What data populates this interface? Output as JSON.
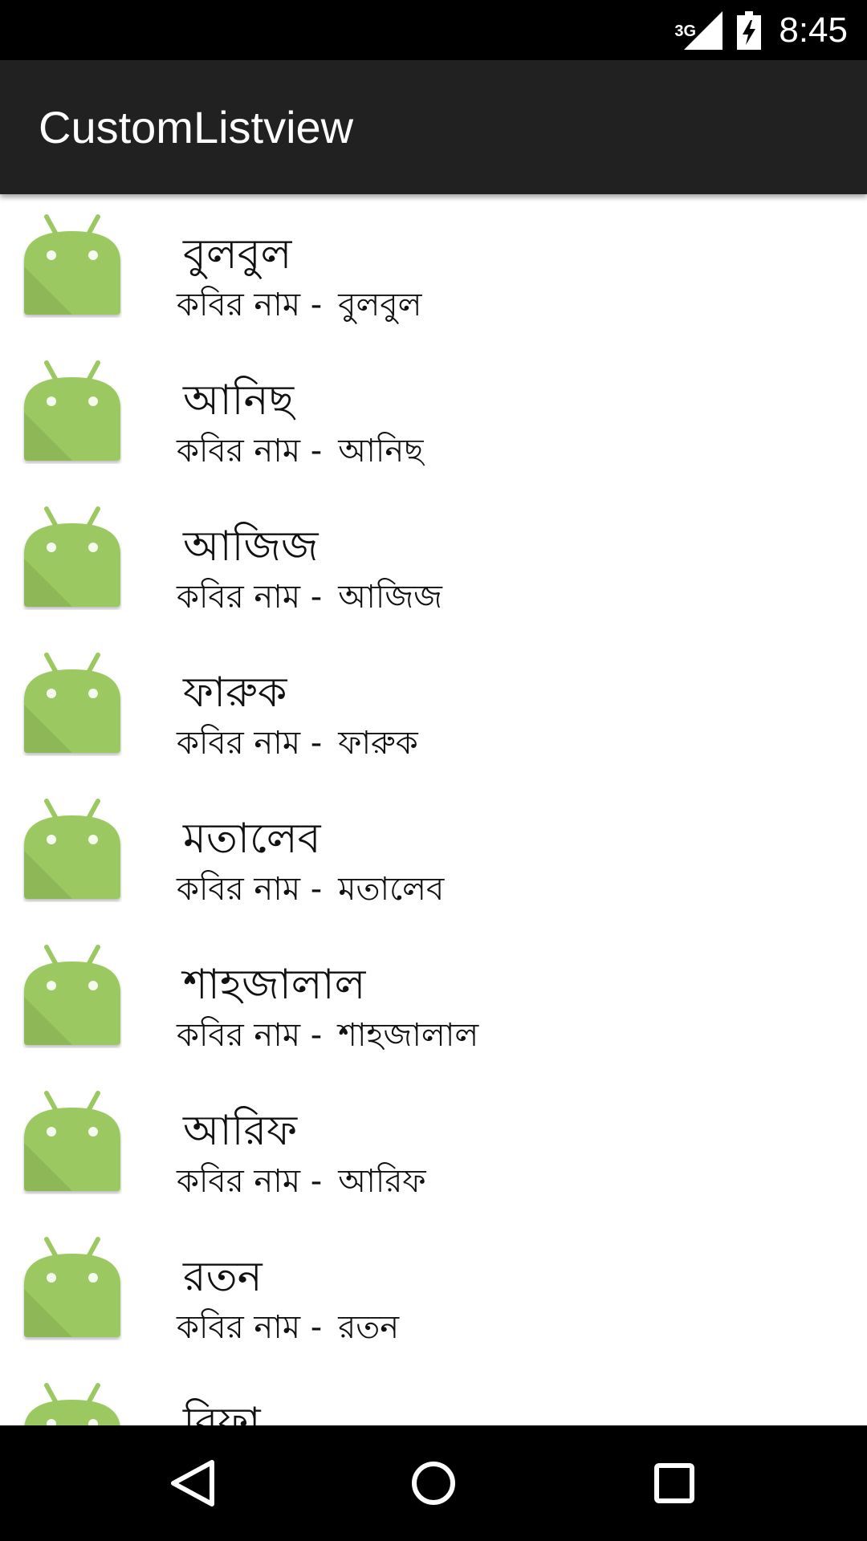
{
  "status_bar": {
    "network": "3G",
    "time": "8:45",
    "icons": [
      "signal-icon",
      "battery-charging-icon"
    ]
  },
  "app_bar": {
    "title": "CustomListview"
  },
  "list": {
    "icon": "android-icon",
    "accent_color": "#9bc860",
    "items": [
      {
        "title": "বুলবুল",
        "subtitle_prefix": "কবির নাম -",
        "subtitle_name": "বুলবুল"
      },
      {
        "title": "আনিছ",
        "subtitle_prefix": "কবির নাম -",
        "subtitle_name": "আনিছ"
      },
      {
        "title": "আজিজ",
        "subtitle_prefix": "কবির নাম -",
        "subtitle_name": "আজিজ"
      },
      {
        "title": "ফারুক",
        "subtitle_prefix": "কবির নাম -",
        "subtitle_name": "ফারুক"
      },
      {
        "title": "মতালেব",
        "subtitle_prefix": "কবির নাম -",
        "subtitle_name": "মতালেব"
      },
      {
        "title": "শাহজালাল",
        "subtitle_prefix": "কবির নাম -",
        "subtitle_name": "শাহজালাল"
      },
      {
        "title": "আরিফ",
        "subtitle_prefix": "কবির নাম -",
        "subtitle_name": "আরিফ"
      },
      {
        "title": "রতন",
        "subtitle_prefix": "কবির নাম -",
        "subtitle_name": "রতন"
      },
      {
        "title": "রিফা",
        "subtitle_prefix": "",
        "subtitle_name": ""
      }
    ]
  },
  "nav_bar": {
    "buttons": [
      "back-icon",
      "home-icon",
      "recent-apps-icon"
    ]
  }
}
